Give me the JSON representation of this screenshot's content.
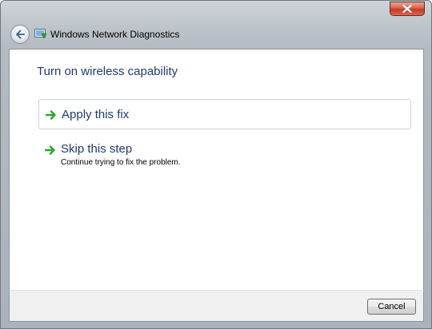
{
  "window": {
    "title": "Windows Network Diagnostics",
    "close_icon": "close-x-icon",
    "back_icon": "back-arrow-icon",
    "app_icon": "network-diagnostics-icon"
  },
  "content": {
    "heading": "Turn on wireless capability",
    "options": [
      {
        "label": "Apply this fix",
        "description": "",
        "icon": "green-arrow-icon"
      },
      {
        "label": "Skip this step",
        "description": "Continue trying to fix the problem.",
        "icon": "green-arrow-icon"
      }
    ]
  },
  "footer": {
    "cancel_label": "Cancel"
  },
  "colors": {
    "heading": "#1e3a73",
    "arrow_green": "#2aa52a",
    "close_red": "#c23a22"
  }
}
